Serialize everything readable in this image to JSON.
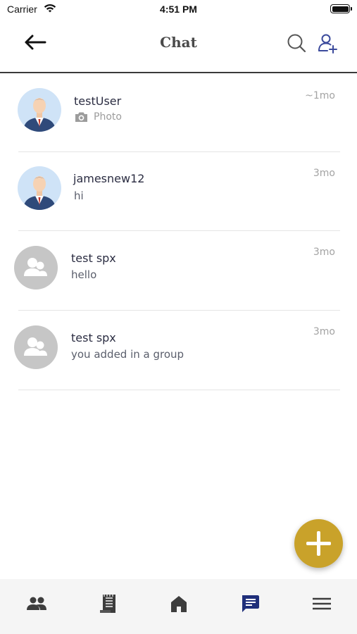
{
  "status_bar": {
    "carrier": "Carrier",
    "time": "4:51 PM"
  },
  "header": {
    "title": "Chat",
    "back_icon": "arrow-left-icon",
    "search_icon": "search-icon",
    "add_user_icon": "user-plus-icon"
  },
  "chats": [
    {
      "name": "testUser",
      "preview": "Photo",
      "preview_type": "photo",
      "time": "~1mo",
      "avatar": "user-photo"
    },
    {
      "name": "jamesnew12",
      "preview": "hi",
      "preview_type": "text",
      "time": "3mo",
      "avatar": "user-photo"
    },
    {
      "name": "test spx",
      "preview": "hello",
      "preview_type": "text",
      "time": "3mo",
      "avatar": "group-icon"
    },
    {
      "name": "test spx",
      "preview": "you added in a group",
      "preview_type": "text",
      "time": "3mo",
      "avatar": "group-icon"
    }
  ],
  "fab": {
    "icon": "plus-icon"
  },
  "bottom_nav": {
    "items": [
      {
        "icon": "people-icon",
        "active": false
      },
      {
        "icon": "notes-icon",
        "active": false
      },
      {
        "icon": "home-icon",
        "active": false
      },
      {
        "icon": "chat-icon",
        "active": true
      },
      {
        "icon": "menu-icon",
        "active": false
      }
    ]
  },
  "colors": {
    "accent": "#c9a22a",
    "nav_active": "#1f2f7a",
    "nav_inactive": "#3d3d3d",
    "text_primary": "#2b2d42",
    "text_muted": "#a3a3a3"
  }
}
